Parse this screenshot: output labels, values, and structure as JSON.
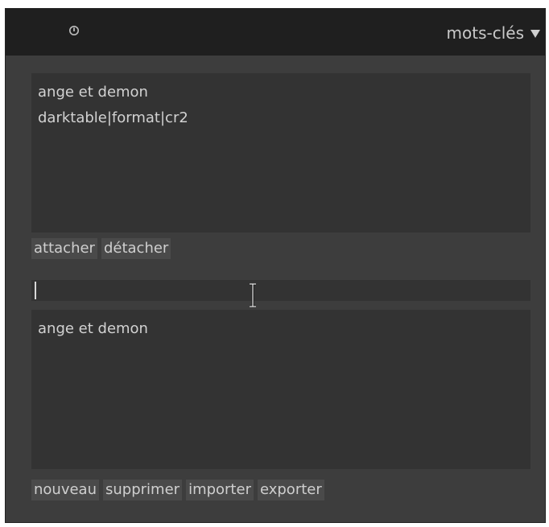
{
  "header": {
    "title": "mots-clés",
    "power_icon": "power-icon",
    "collapse_icon": "triangle-down-icon"
  },
  "attached_tags": [
    "ange et demon",
    "darktable|format|cr2"
  ],
  "attach_buttons": {
    "attach": "attacher",
    "detach": "détacher"
  },
  "tag_entry": {
    "value": ""
  },
  "dictionary_tags": [
    "ange et demon"
  ],
  "dictionary_buttons": {
    "new": "nouveau",
    "delete": "supprimer",
    "import": "importer",
    "export": "exporter"
  }
}
